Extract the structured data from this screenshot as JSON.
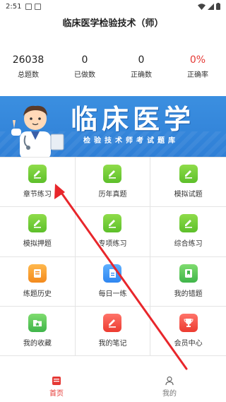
{
  "status_bar": {
    "time": "2:51"
  },
  "app": {
    "title": "临床医学检验技术（师）"
  },
  "stats": [
    {
      "value": "26038",
      "label": "总题数",
      "highlight": false
    },
    {
      "value": "0",
      "label": "已做数",
      "highlight": false
    },
    {
      "value": "0",
      "label": "正确数",
      "highlight": false
    },
    {
      "value": "0%",
      "label": "正确率",
      "highlight": true
    }
  ],
  "banner": {
    "title": "临床医学",
    "subtitle": "检验技术师考试题库"
  },
  "grid": [
    {
      "label": "章节练习",
      "icon": "edit-icon",
      "color": "green"
    },
    {
      "label": "历年真题",
      "icon": "edit-icon",
      "color": "green"
    },
    {
      "label": "模拟试题",
      "icon": "edit-icon",
      "color": "green"
    },
    {
      "label": "模拟押题",
      "icon": "edit-icon",
      "color": "green"
    },
    {
      "label": "专项练习",
      "icon": "edit-icon",
      "color": "green"
    },
    {
      "label": "综合练习",
      "icon": "edit-icon",
      "color": "green"
    },
    {
      "label": "练题历史",
      "icon": "history-icon",
      "color": "orange"
    },
    {
      "label": "每日一练",
      "icon": "document-icon",
      "color": "blue"
    },
    {
      "label": "我的错题",
      "icon": "bookmark-icon",
      "color": "lgreen"
    },
    {
      "label": "我的收藏",
      "icon": "folder-icon",
      "color": "lgreen"
    },
    {
      "label": "我的笔记",
      "icon": "edit-icon",
      "color": "red"
    },
    {
      "label": "会员中心",
      "icon": "trophy-icon",
      "color": "red"
    }
  ],
  "tabs": [
    {
      "label": "首页",
      "icon": "home-icon",
      "active": true
    },
    {
      "label": "我的",
      "icon": "person-icon",
      "active": false
    }
  ],
  "accent_color": "#e53935"
}
